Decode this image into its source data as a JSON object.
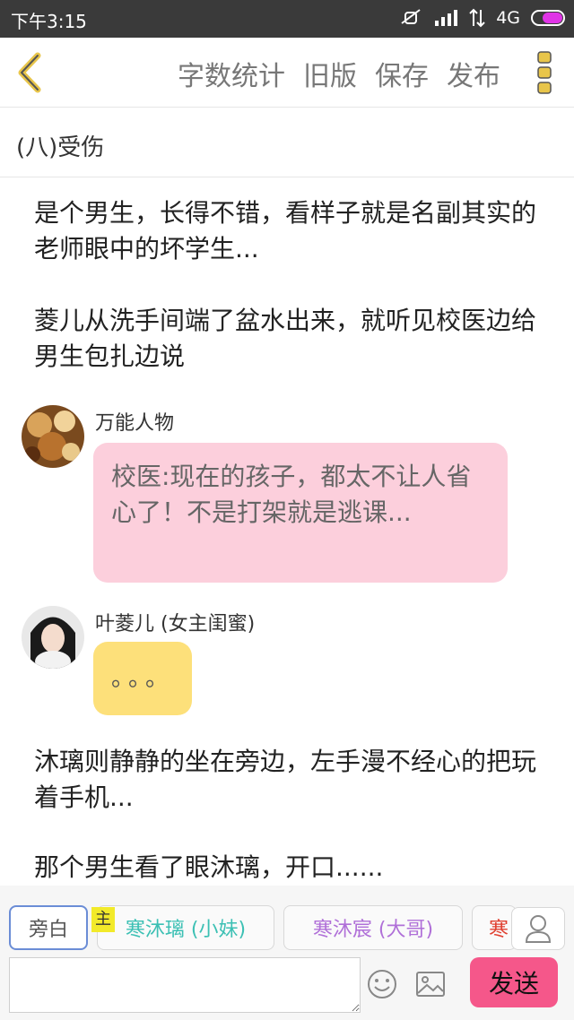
{
  "status_bar": {
    "time": "下午3:15",
    "network": "4G"
  },
  "toolbar": {
    "actions": [
      "字数统计",
      "旧版",
      "保存",
      "发布"
    ]
  },
  "chapter": {
    "title": "(八)受伤"
  },
  "story": {
    "para1": "是个男生，长得不错，看样子就是名副其实的老师眼中的坏学生...",
    "para2": "菱儿从洗手间端了盆水出来，就听见校医边给男生包扎边说",
    "dialog1": {
      "speaker": "万能人物",
      "text": "校医:现在的孩子，都太不让人省心了！不是打架就是逃课...",
      "bubble_color": "#fccfdc"
    },
    "dialog2": {
      "speaker": "叶菱儿 (女主闺蜜)",
      "text": "。。。",
      "bubble_color": "#fde07a"
    },
    "para3": "沐璃则静静的坐在旁边，左手漫不经心的把玩着手机...",
    "para4": "那个男生看了眼沐璃，开口......"
  },
  "roles": {
    "narration": "旁白",
    "main_tag": "主",
    "role1": "寒沐璃 (小妹)",
    "role2": "寒沐宸 (大哥)",
    "role3": "寒",
    "colors": {
      "role1": "#3cc0b4",
      "role2": "#b070d8",
      "role3": "#e04030"
    }
  },
  "input": {
    "placeholder": "",
    "send_label": "发送"
  },
  "colors": {
    "accent": "#f5578a",
    "toolbar_icon": "#e8c54a"
  }
}
